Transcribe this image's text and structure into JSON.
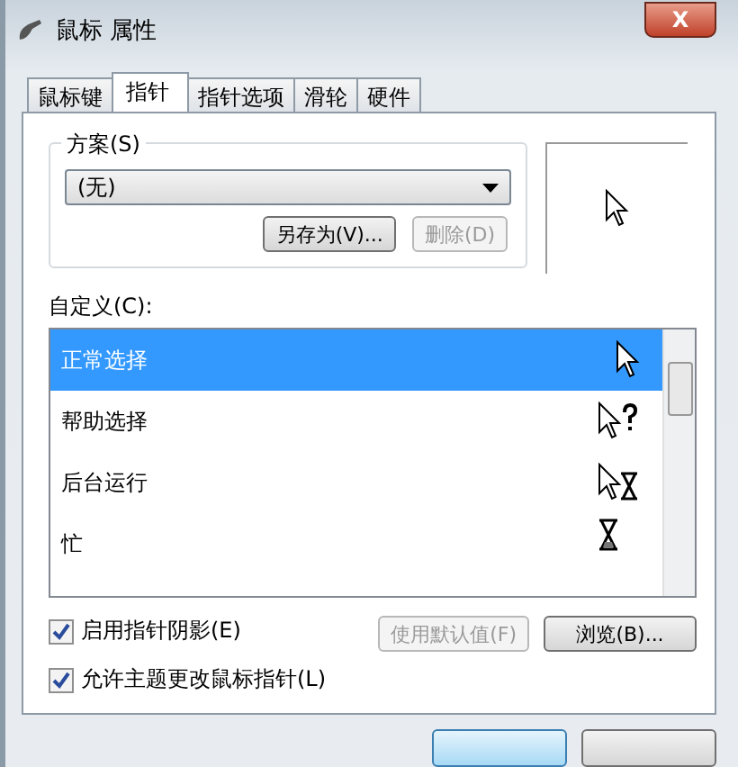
{
  "window": {
    "title": "鼠标 属性",
    "close": "X"
  },
  "tabs": [
    {
      "label": "鼠标键",
      "selected": false
    },
    {
      "label": "指针",
      "selected": true
    },
    {
      "label": "指针选项",
      "selected": false
    },
    {
      "label": "滑轮",
      "selected": false
    },
    {
      "label": "硬件",
      "selected": false
    }
  ],
  "scheme": {
    "label": "方案(S)",
    "value": "(无)",
    "buttons": [
      {
        "label": "另存为(V)...",
        "disabled": false
      },
      {
        "label": "删除(D)",
        "disabled": true
      }
    ]
  },
  "customize": {
    "label": "自定义(C):",
    "items": [
      {
        "name": "正常选择",
        "kind": "arrow",
        "selected": true
      },
      {
        "name": "帮助选择",
        "kind": "help",
        "selected": false
      },
      {
        "name": "后台运行",
        "kind": "working",
        "selected": false
      },
      {
        "name": "忙",
        "kind": "busy",
        "selected": false
      }
    ]
  },
  "options": [
    {
      "label": "启用指针阴影(E)",
      "checked": true
    },
    {
      "label": "允许主题更改鼠标指针(L)",
      "checked": true
    }
  ],
  "cursor_buttons": [
    {
      "label": "使用默认值(F)",
      "disabled": true
    },
    {
      "label": "浏览(B)...",
      "disabled": false
    }
  ]
}
